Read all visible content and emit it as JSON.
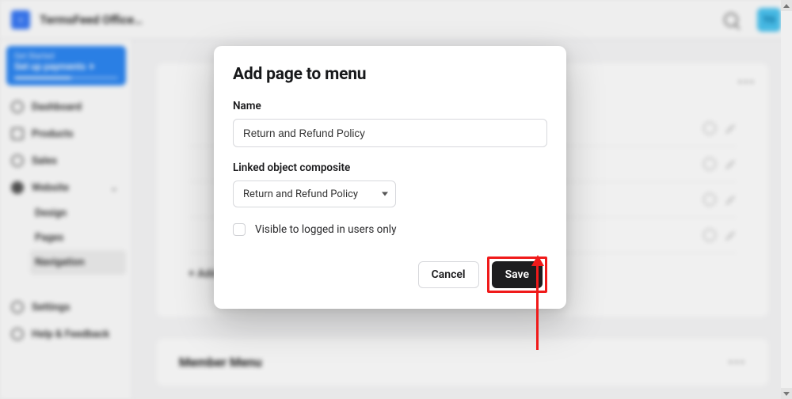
{
  "topbar": {
    "workspace_name": "TermsFeed Office…",
    "logo_letter": "‹",
    "avatar_initials": "TO"
  },
  "sidebar": {
    "get_started": {
      "eyebrow": "Get Started",
      "title": "Set up payments"
    },
    "items": [
      {
        "label": "Dashboard"
      },
      {
        "label": "Products"
      },
      {
        "label": "Sales"
      },
      {
        "label": "Website"
      }
    ],
    "website_sub": [
      {
        "label": "Design"
      },
      {
        "label": "Pages"
      },
      {
        "label": "Navigation"
      }
    ],
    "footer": [
      {
        "label": "Settings"
      },
      {
        "label": "Help & Feedback"
      }
    ]
  },
  "main": {
    "add_label": "+ Add",
    "member_menu_title": "Member Menu"
  },
  "modal": {
    "title": "Add page to menu",
    "name_label": "Name",
    "name_value": "Return and Refund Policy",
    "linked_label": "Linked object composite",
    "linked_value": "Return and Refund Policy",
    "visible_label": "Visible to logged in users only",
    "cancel_label": "Cancel",
    "save_label": "Save"
  }
}
